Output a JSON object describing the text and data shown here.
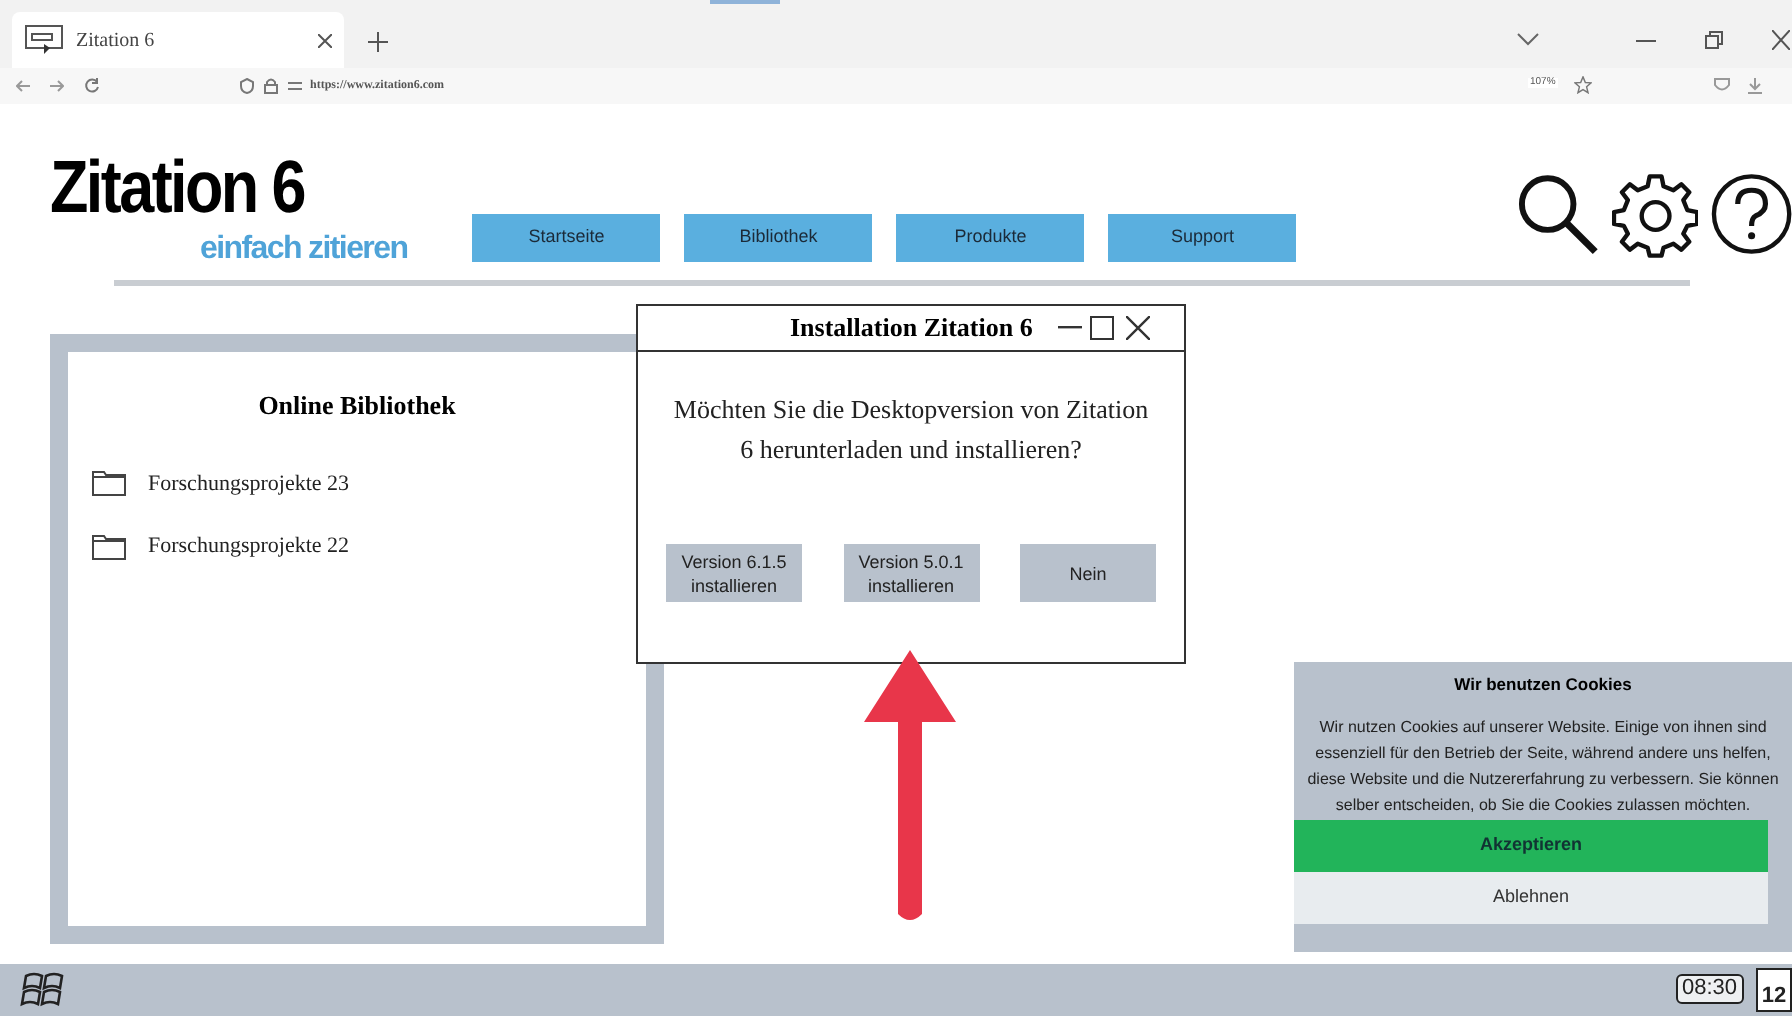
{
  "browser": {
    "tab_title": "Zitation 6",
    "url": "https://www.zitation6.com",
    "zoom": "107%"
  },
  "header": {
    "logo": "Zitation 6",
    "tagline": "einfach zitieren",
    "nav": [
      {
        "label": "Startseite"
      },
      {
        "label": "Bibliothek"
      },
      {
        "label": "Produkte"
      },
      {
        "label": "Support"
      }
    ]
  },
  "library": {
    "title": "Online Bibliothek",
    "folders": [
      {
        "label": "Forschungsprojekte 23"
      },
      {
        "label": "Forschungsprojekte 22"
      }
    ]
  },
  "dialog": {
    "title": "Installation Zitation 6",
    "message": "Möchten Sie die Desktopversion von Zitation 6 herunterladen und installieren?",
    "buttons": [
      {
        "label": "Version 6.1.5 installieren"
      },
      {
        "label": "Version 5.0.1 installieren"
      },
      {
        "label": "Nein"
      }
    ]
  },
  "cookies": {
    "title": "Wir benutzen Cookies",
    "text": "Wir nutzen Cookies auf unserer Website. Einige von ihnen sind essenziell für den Betrieb der Seite, während andere uns helfen, diese Website und die Nutzererfahrung zu verbessern. Sie können selber entscheiden, ob Sie die Cookies zulassen möchten.",
    "buttons": [
      {
        "label": "Akzeptieren",
        "kind": "accept"
      },
      {
        "label": "Ablehnen",
        "kind": "decline"
      }
    ]
  },
  "taskbar": {
    "time": "08:30",
    "date": "12"
  }
}
